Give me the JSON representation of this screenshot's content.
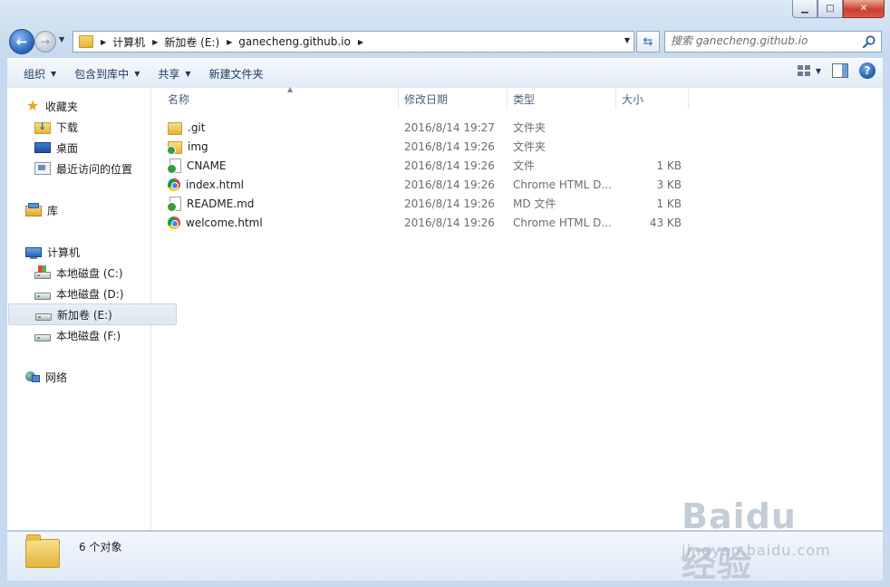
{
  "window": {
    "controls": {
      "minimize": "▁",
      "maximize": "□",
      "close": "✕"
    }
  },
  "nav": {
    "breadcrumbs": [
      "计算机",
      "新加卷 (E:)",
      "ganecheng.github.io"
    ],
    "search_placeholder": "搜索 ganecheng.github.io"
  },
  "toolbar": {
    "organize": "组织",
    "include_in_library": "包含到库中",
    "share": "共享",
    "new_folder": "新建文件夹"
  },
  "sidebar": {
    "favorites": {
      "label": "收藏夹",
      "items": [
        "下载",
        "桌面",
        "最近访问的位置"
      ]
    },
    "libraries": {
      "label": "库"
    },
    "computer": {
      "label": "计算机",
      "drives": [
        "本地磁盘 (C:)",
        "本地磁盘 (D:)",
        "新加卷 (E:)",
        "本地磁盘 (F:)"
      ],
      "selected": "新加卷 (E:)"
    },
    "network": {
      "label": "网络"
    }
  },
  "filelist": {
    "columns": {
      "name": "名称",
      "date": "修改日期",
      "type": "类型",
      "size": "大小"
    },
    "rows": [
      {
        "name": ".git",
        "date": "2016/8/14 19:27",
        "type": "文件夹",
        "size": "",
        "icon": "folder-icon"
      },
      {
        "name": "img",
        "date": "2016/8/14 19:26",
        "type": "文件夹",
        "size": "",
        "icon": "folder-icon"
      },
      {
        "name": "CNAME",
        "date": "2016/8/14 19:26",
        "type": "文件",
        "size": "1 KB",
        "icon": "file-icon"
      },
      {
        "name": "index.html",
        "date": "2016/8/14 19:26",
        "type": "Chrome HTML D...",
        "size": "3 KB",
        "icon": "chrome-html-icon"
      },
      {
        "name": "README.md",
        "date": "2016/8/14 19:26",
        "type": "MD 文件",
        "size": "1 KB",
        "icon": "file-icon"
      },
      {
        "name": "welcome.html",
        "date": "2016/8/14 19:26",
        "type": "Chrome HTML D...",
        "size": "43 KB",
        "icon": "chrome-html-icon"
      }
    ]
  },
  "status": {
    "count": "6 个对象"
  },
  "watermark": {
    "logo": "Baidu 经验",
    "url": "jingyan.baidu.com"
  }
}
